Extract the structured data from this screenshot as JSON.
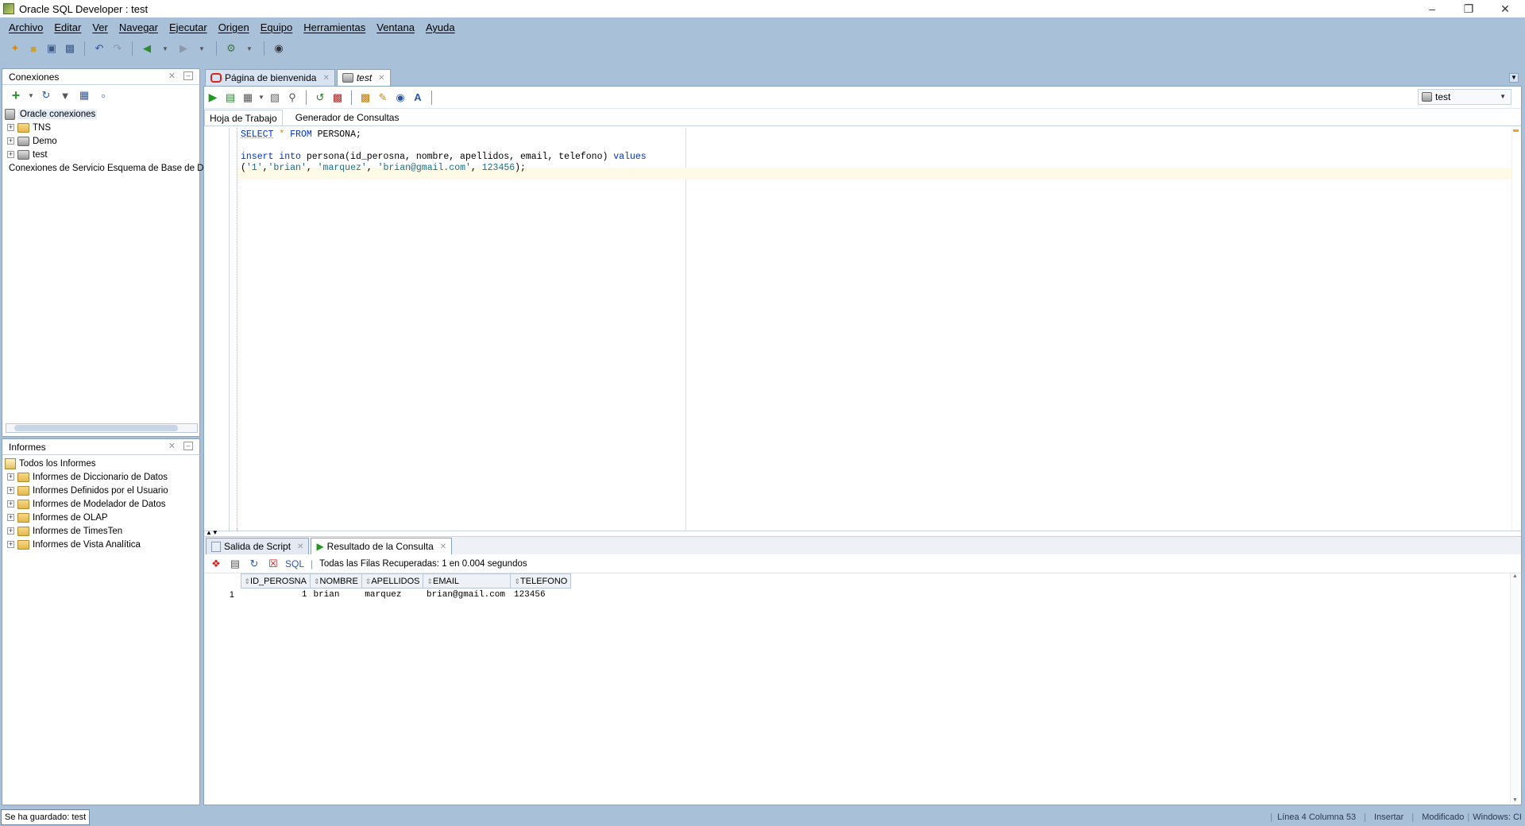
{
  "window": {
    "title": "Oracle SQL Developer : test"
  },
  "menu": [
    "Archivo",
    "Editar",
    "Ver",
    "Navegar",
    "Ejecutar",
    "Origen",
    "Equipo",
    "Herramientas",
    "Ventana",
    "Ayuda"
  ],
  "connections": {
    "title": "Conexiones",
    "root": "Oracle conexiones",
    "items": [
      "TNS",
      "Demo",
      "test"
    ],
    "schema_service": "Conexiones de Servicio Esquema de Base de Da"
  },
  "reports": {
    "title": "Informes",
    "root": "Todos los Informes",
    "items": [
      "Informes de Diccionario de Datos",
      "Informes Definidos por el Usuario",
      "Informes de Modelador de Datos",
      "Informes de OLAP",
      "Informes de TimesTen",
      "Informes de Vista Analítica"
    ]
  },
  "editor": {
    "tabs": [
      "Página de bienvenida",
      "test"
    ],
    "connection_select": "test",
    "subtabs": [
      "Hoja de Trabajo",
      "Generador de Consultas"
    ],
    "lines": {
      "l1_kw1": "SELECT",
      "l1_star": "*",
      "l1_kw2": "FROM",
      "l1_rest": "PERSONA;",
      "l3_kw": "insert into",
      "l3_mid": "persona(id_perosna, nombre, apellidos, email, telefono)",
      "l3_kw2": "values",
      "l4_open": "(",
      "l4_s1": "'1'",
      "l4_c1": ",",
      "l4_s2": "'brian'",
      "l4_c2": ", ",
      "l4_s3": "'marquez'",
      "l4_c3": ", ",
      "l4_s4": "'brian@gmail.com'",
      "l4_c4": ", ",
      "l4_num": "123456",
      "l4_end": ");"
    }
  },
  "output": {
    "tabs": [
      "Salida de Script",
      "Resultado de la Consulta"
    ],
    "sql_label": "SQL",
    "status": "Todas las Filas Recuperadas: 1 en 0.004 segundos",
    "columns": [
      "ID_PEROSNA",
      "NOMBRE",
      "APELLIDOS",
      "EMAIL",
      "TELEFONO"
    ],
    "rows": [
      {
        "n": "1",
        "id": "1",
        "nombre": "brian",
        "apellidos": "marquez",
        "email": "brian@gmail.com",
        "telefono": "123456"
      }
    ]
  },
  "statusbar": {
    "left": "Se ha guardado: test",
    "position": "Línea 4 Columna 53",
    "mode": "Insertar",
    "modified": "Modificado",
    "windows": "Windows: CI"
  },
  "colors": {
    "chrome": "#a9c0d9",
    "keyword": "#0033cc",
    "string": "#1a6e8a"
  }
}
